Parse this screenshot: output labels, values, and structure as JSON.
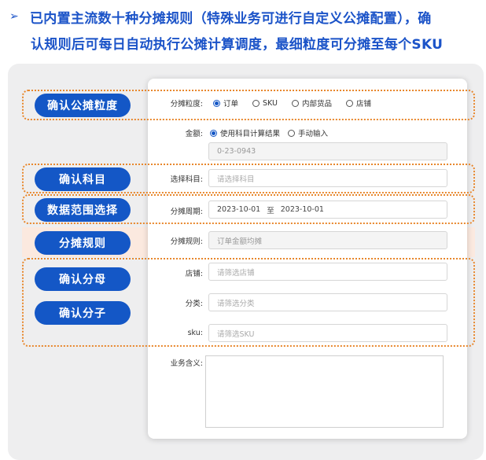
{
  "heading": {
    "arrow": "➢",
    "line1": "已内置主流数十种分摊规则（特殊业务可进行自定义公摊配置），确",
    "line2": "认规则后可每日自动执行公摊计算调度，最细粒度可分摊至每个SKU"
  },
  "steps": {
    "granularity": "确认公摊粒度",
    "subject": "确认科目",
    "range": "数据范围选择",
    "rule": "分摊规则",
    "denominator": "确认分母",
    "numerator": "确认分子"
  },
  "form": {
    "granularity": {
      "label": "分摊粒度:",
      "options": [
        {
          "label": "订单",
          "selected": true
        },
        {
          "label": "SKU",
          "selected": false
        },
        {
          "label": "内部货品",
          "selected": false
        },
        {
          "label": "店铺",
          "selected": false
        }
      ]
    },
    "amount": {
      "label": "金额:",
      "options": [
        {
          "label": "使用科目计算结果",
          "selected": true
        },
        {
          "label": "手动输入",
          "selected": false
        }
      ],
      "value": "0-23-0943"
    },
    "subject": {
      "label": "选择科目:",
      "placeholder": "请选择科目"
    },
    "period": {
      "label": "分摊周期:",
      "start": "2023-10-01",
      "sep": "至",
      "end": "2023-10-01"
    },
    "rule": {
      "label": "分摊规则:",
      "value": "订单金额均摊"
    },
    "shop": {
      "label": "店铺:",
      "placeholder": "请筛选店铺"
    },
    "category": {
      "label": "分类:",
      "placeholder": "请筛选分类"
    },
    "sku": {
      "label": "sku:",
      "placeholder": "请筛选SKU"
    },
    "meaning": {
      "label": "业务含义:"
    }
  },
  "colors": {
    "accent": "#1457c6",
    "heading": "#1b53c8",
    "highlight_border": "#e8872c",
    "highlight_fill": "#fbe9df"
  }
}
